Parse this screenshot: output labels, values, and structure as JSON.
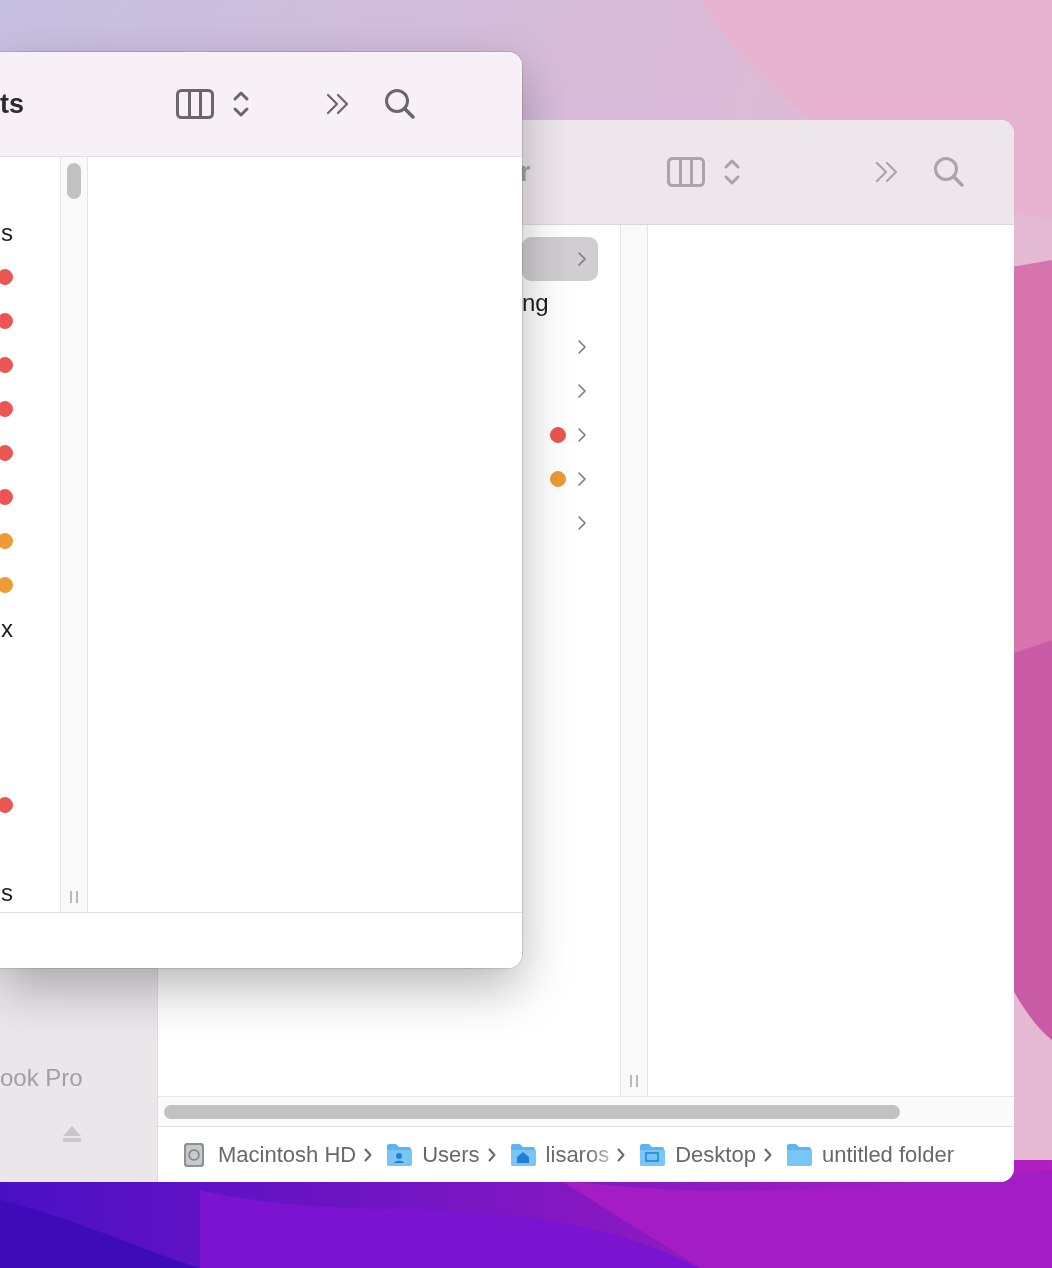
{
  "back_window": {
    "title": "r",
    "sidebar": {
      "items": [
        {
          "label": "ook Pro",
          "ejectable": false
        },
        {
          "ejectable": true
        }
      ]
    },
    "columns": [
      {
        "rows": [
          {
            "kind": "folder",
            "selected": true
          },
          {
            "kind": "file",
            "label": "ng",
            "selected": false
          },
          {
            "kind": "folder",
            "selected": false
          },
          {
            "kind": "folder",
            "selected": false
          },
          {
            "kind": "folder",
            "selected": false,
            "color": "#ec5552"
          },
          {
            "kind": "folder",
            "selected": false,
            "color": "#ee9a35"
          },
          {
            "kind": "folder",
            "selected": false
          }
        ]
      }
    ],
    "path_bar": [
      {
        "kind": "disk",
        "label": "Macintosh HD",
        "faded": false
      },
      {
        "kind": "users",
        "label": "Users",
        "faded": false
      },
      {
        "kind": "home",
        "label": "lisaros",
        "faded": true
      },
      {
        "kind": "desktop",
        "label": "Desktop",
        "faded": false
      },
      {
        "kind": "folder",
        "label": "untitled folder",
        "faded": false
      }
    ]
  },
  "front_window": {
    "title": "ts",
    "column": {
      "rows": [
        {},
        {
          "label": "s"
        },
        {
          "color": "#ec5552"
        },
        {
          "color": "#ec5552"
        },
        {
          "color": "#ec5552"
        },
        {
          "color": "#ec5552"
        },
        {
          "color": "#ec5552"
        },
        {
          "color": "#ec5552"
        },
        {
          "color": "#ee9a35"
        },
        {
          "color": "#ee9a35"
        },
        {
          "label": "x"
        },
        {},
        {},
        {},
        {
          "color": "#ec5552"
        },
        {},
        {
          "label": "s"
        }
      ]
    }
  }
}
